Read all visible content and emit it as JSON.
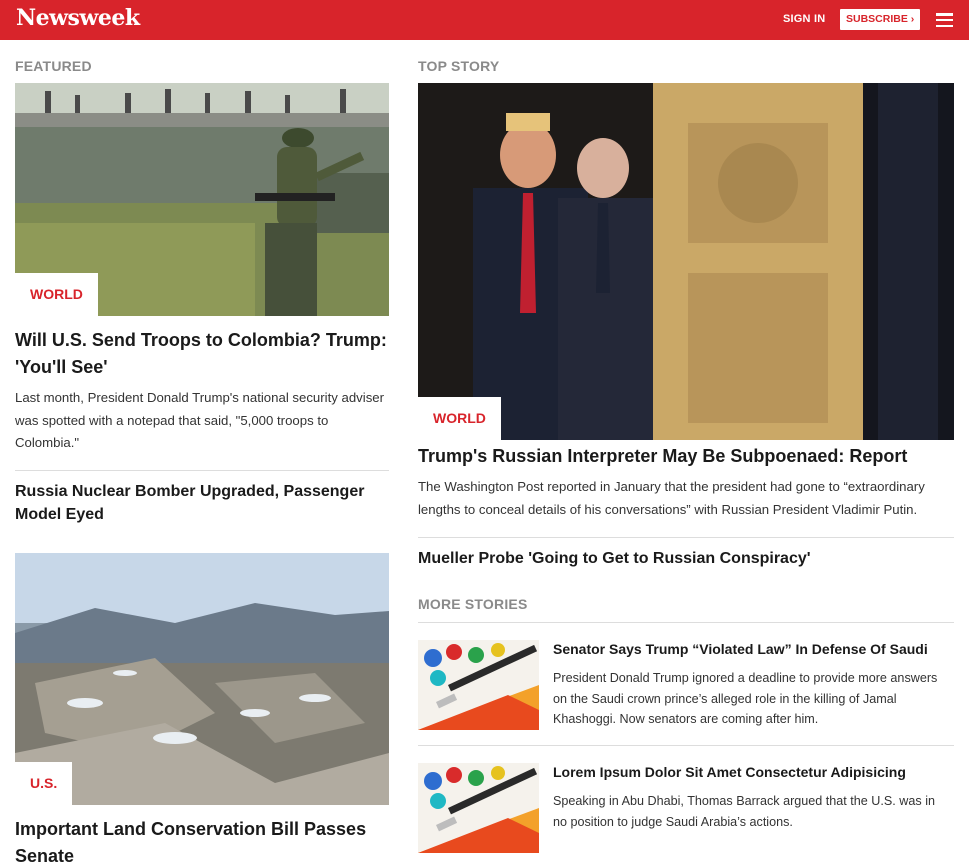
{
  "header": {
    "logo": "Newsweek",
    "sign_in": "SIGN IN",
    "subscribe": "SUBSCRIBE ›"
  },
  "featured": {
    "label": "FEATURED",
    "lead": {
      "tag": "WORLD",
      "headline": "Will U.S. Send Troops to Colombia? Trump: 'You'll See'",
      "dek": "Last month, President Donald Trump's national security adviser was spotted with a notepad that said, \"5,000 troops to Colombia.\""
    },
    "secondary_headline": "Russia Nuclear Bomber Upgraded, Passenger Model Eyed",
    "second": {
      "tag": "U.S.",
      "headline": "Important Land Conservation Bill Passes Senate"
    }
  },
  "top_story": {
    "label": "TOP STORY",
    "tag": "WORLD",
    "headline": "Trump's Russian Interpreter May Be Subpoenaed: Report",
    "dek": "The Washington Post reported in January that the president had gone to “extraordinary lengths to conceal details of his conversations” with Russian President Vladimir Putin.",
    "related_headline": "Mueller Probe 'Going to Get to Russian Conspiracy'"
  },
  "more_stories": {
    "label": "MORE STORIES",
    "items": [
      {
        "title": "Senator Says Trump “Violated Law” In Defense Of Saudi",
        "dek": "President Donald Trump ignored a deadline to provide more answers on the Saudi crown prince’s alleged role in the killing of Jamal Khashoggi. Now senators are coming after him."
      },
      {
        "title": "Lorem Ipsum Dolor Sit Amet Consectetur Adipisicing",
        "dek": "Speaking in Abu Dhabi, Thomas Barrack argued that the U.S. was in no position to judge Saudi Arabia’s actions."
      }
    ]
  },
  "colors": {
    "brand_red": "#d8242b",
    "label_gray": "#8a8a8a"
  }
}
